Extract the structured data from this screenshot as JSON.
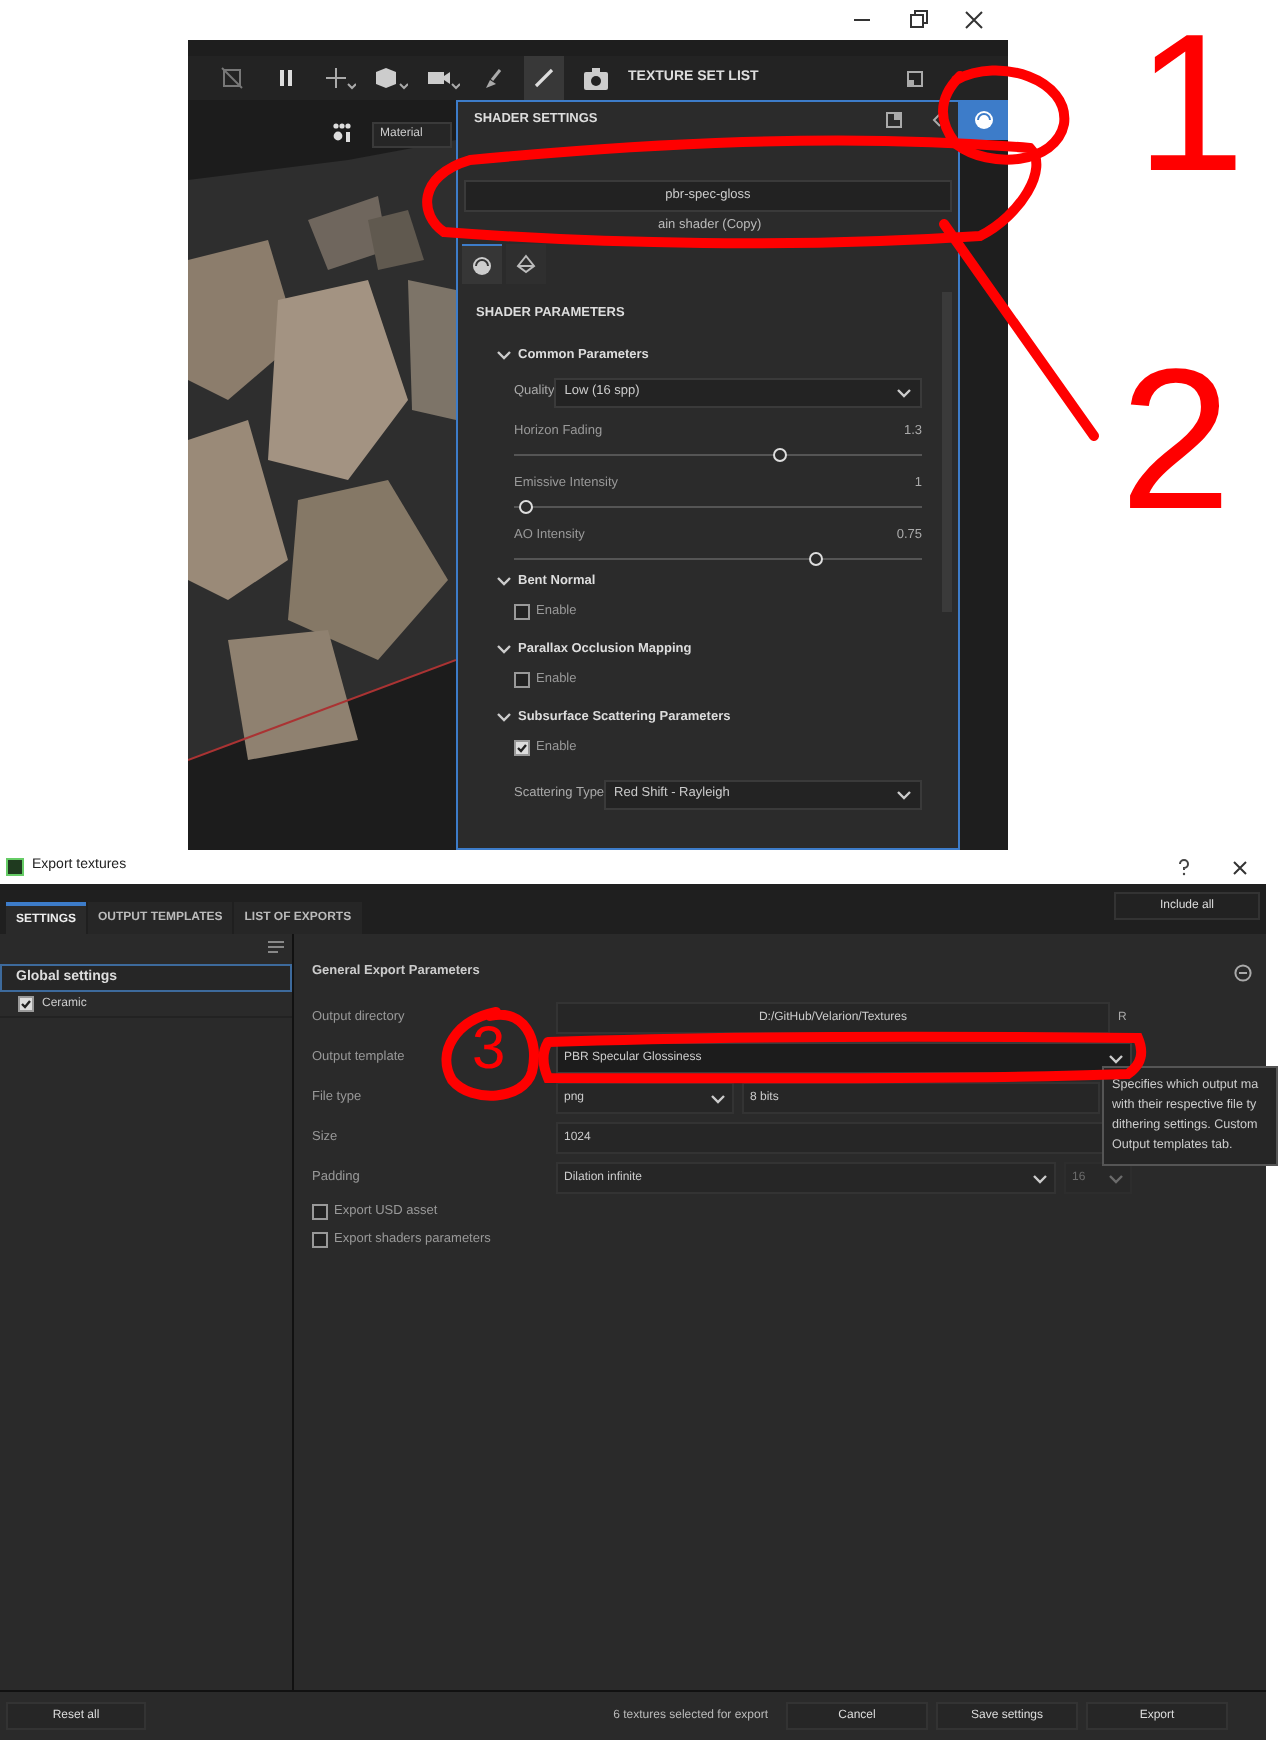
{
  "editor_window": {
    "toolbar": {
      "panel_title": "TEXTURE SET LIST"
    },
    "viewport": {
      "kind": "picture",
      "material_dropdown": "Material"
    },
    "shader_settings": {
      "title": "SHADER SETTINGS",
      "shader_button": "pbr-spec-gloss",
      "shader_name": "ain shader (Copy)",
      "tabs": [
        {
          "kind": "shader",
          "selected": true
        },
        {
          "kind": "geometry",
          "selected": false
        }
      ],
      "section_title": "SHADER PARAMETERS",
      "groups": [
        {
          "title": "Common Parameters",
          "expanded": true,
          "rows": [
            {
              "kind": "dropdown",
              "label": "Quality",
              "value": "Low (16 spp)"
            },
            {
              "kind": "slider",
              "label": "Horizon Fading",
              "reading": "1.3",
              "level": 0.65
            },
            {
              "kind": "slider",
              "label": "Emissive Intensity",
              "reading": "1",
              "level": 0.03
            },
            {
              "kind": "slider",
              "label": "AO Intensity",
              "reading": "0.75",
              "level": 0.74
            }
          ]
        },
        {
          "title": "Bent Normal",
          "expanded": true,
          "rows": [
            {
              "kind": "checkbox",
              "label": "Enable",
              "checked": false
            }
          ]
        },
        {
          "title": "Parallax Occlusion Mapping",
          "expanded": true,
          "rows": [
            {
              "kind": "checkbox",
              "label": "Enable",
              "checked": false
            }
          ]
        },
        {
          "title": "Subsurface Scattering Parameters",
          "expanded": true,
          "rows": [
            {
              "kind": "checkbox",
              "label": "Enable",
              "checked": true
            },
            {
              "kind": "dropdown",
              "label": "Scattering Type",
              "value": "Red Shift - Rayleigh"
            }
          ]
        }
      ]
    }
  },
  "export_window": {
    "title": "Export textures",
    "tabs": [
      {
        "label": "SETTINGS",
        "selected": true
      },
      {
        "label": "OUTPUT TEMPLATES",
        "selected": false
      },
      {
        "label": "LIST OF EXPORTS",
        "selected": false
      }
    ],
    "include_all_button": "Include all",
    "sidebar": {
      "heading": {
        "label": "Global settings",
        "selected": true
      },
      "items": [
        {
          "label": "Ceramic",
          "checked": true
        }
      ]
    },
    "params": {
      "title": "General Export Parameters",
      "rows": [
        {
          "label": "Output directory",
          "controls": [
            {
              "kind": "field",
              "value": "D:/GitHub/Velarion/Textures"
            }
          ],
          "suffix": "R"
        },
        {
          "label": "Output template",
          "controls": [
            {
              "kind": "dropdown",
              "value": "PBR Specular Glossiness"
            }
          ]
        },
        {
          "label": "File type",
          "controls": [
            {
              "kind": "dropdown",
              "value": "png"
            },
            {
              "kind": "field",
              "value": "8 bits"
            }
          ]
        },
        {
          "label": "Size",
          "controls": [
            {
              "kind": "field",
              "value": "1024"
            }
          ]
        },
        {
          "label": "Padding",
          "controls": [
            {
              "kind": "dropdown",
              "value": "Dilation infinite",
              "disabled": false
            },
            {
              "kind": "dropdown",
              "value": "16",
              "disabled": true
            }
          ]
        }
      ],
      "checkboxes": [
        {
          "label": "Export USD asset",
          "checked": false
        },
        {
          "label": "Export shaders parameters",
          "checked": false
        }
      ]
    },
    "tooltip": [
      "Specifies which output ma",
      "with their respective file ty",
      "dithering settings. Custom",
      "Output templates tab."
    ],
    "footer": {
      "reset_button": "Reset all",
      "status": "6 textures selected for export",
      "buttons": [
        "Cancel",
        "Save settings",
        "Export"
      ]
    }
  },
  "annotations": [
    {
      "text": "1"
    },
    {
      "text": "2"
    },
    {
      "text": "3"
    }
  ]
}
